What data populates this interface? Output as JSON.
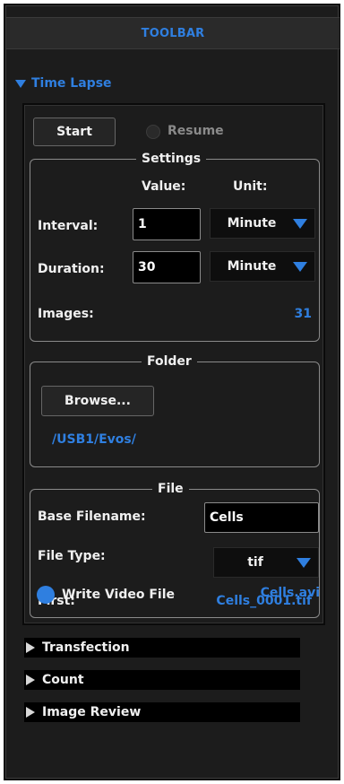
{
  "toolbar": {
    "title": "TOOLBAR"
  },
  "time_lapse": {
    "title": "Time Lapse",
    "start_label": "Start",
    "resume_label": "Resume",
    "settings": {
      "title": "Settings",
      "value_header": "Value:",
      "unit_header": "Unit:",
      "interval_label": "Interval:",
      "interval_value": "1",
      "interval_unit": "Minute",
      "duration_label": "Duration:",
      "duration_value": "30",
      "duration_unit": "Minute",
      "images_label": "Images:",
      "images_value": "31"
    },
    "folder": {
      "title": "Folder",
      "browse_label": "Browse...",
      "path": "/USB1/Evos/"
    },
    "file": {
      "title": "File",
      "base_filename_label": "Base Filename:",
      "base_filename_value": "Cells",
      "file_type_label": "File Type:",
      "file_type_value": "tif",
      "first_label": "First:",
      "first_value": "Cells_0001.tif",
      "write_video_label": "Write Video File",
      "video_filename": "Cells.avi"
    }
  },
  "collapsed_sections": [
    {
      "label": "Transfection"
    },
    {
      "label": "Count"
    },
    {
      "label": "Image Review"
    }
  ],
  "colors": {
    "accent": "#2f7fe0",
    "background": "#1c1c1c",
    "text": "#f0f0f0"
  }
}
